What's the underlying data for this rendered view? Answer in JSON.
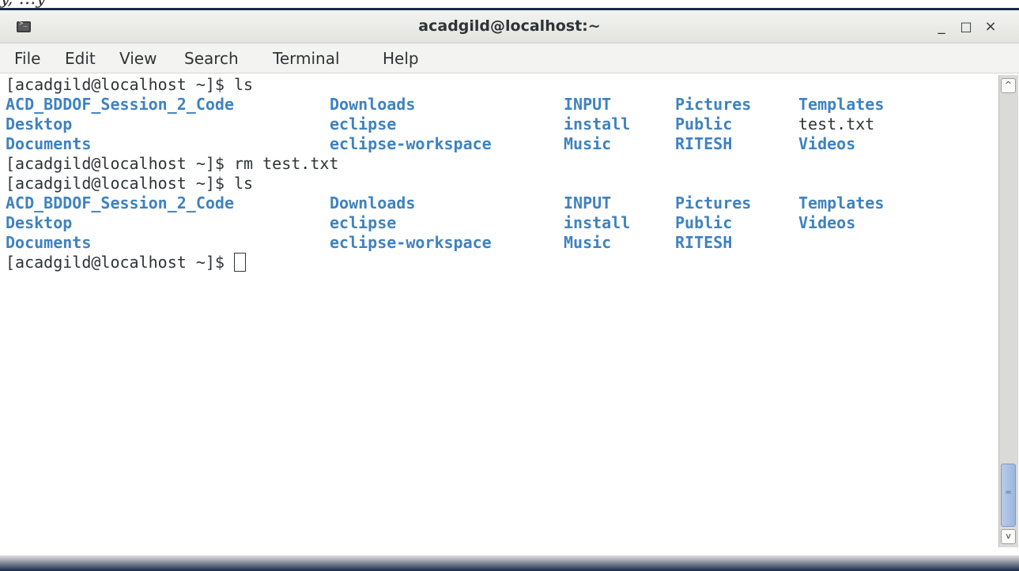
{
  "top_strip_text": "y, …y",
  "window": {
    "title": "acadgild@localhost:~",
    "icon": "terminal-icon",
    "controls": {
      "minimize": "_",
      "maximize": "□",
      "close": "×"
    }
  },
  "menubar": {
    "items": [
      "File",
      "Edit",
      "View",
      "Search",
      "Terminal",
      "Help"
    ]
  },
  "terminal": {
    "prompt_ls_1": "[acadgild@localhost ~]$ ls",
    "ls1": [
      [
        "ACD_BDDOF_Session_2_Code",
        "Downloads",
        "INPUT",
        "Pictures",
        "Templates"
      ],
      [
        "Desktop",
        "eclipse",
        "install",
        "Public",
        "test.txt"
      ],
      [
        "Documents",
        "eclipse-workspace",
        "Music",
        "RITESH",
        "Videos"
      ]
    ],
    "prompt_rm": "[acadgild@localhost ~]$ rm test.txt",
    "prompt_ls_2": "[acadgild@localhost ~]$ ls",
    "ls2": [
      [
        "ACD_BDDOF_Session_2_Code",
        "Downloads",
        "INPUT",
        "Pictures",
        "Templates"
      ],
      [
        "Desktop",
        "eclipse",
        "install",
        "Public",
        "Videos"
      ],
      [
        "Documents",
        "eclipse-workspace",
        "Music",
        "RITESH"
      ]
    ],
    "prompt_final": "[acadgild@localhost ~]$ "
  },
  "scrollbar": {
    "up_arrow": "^",
    "down_arrow": "v",
    "grip": "="
  }
}
